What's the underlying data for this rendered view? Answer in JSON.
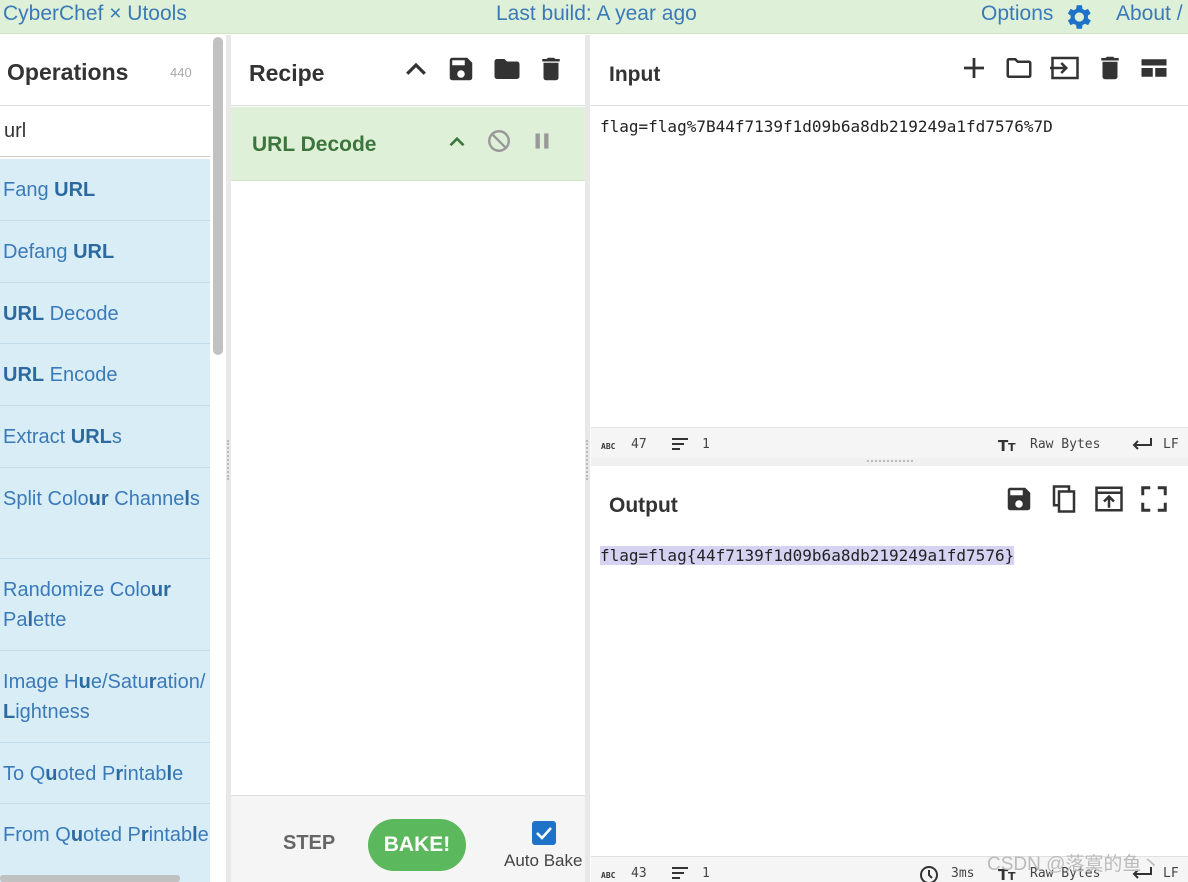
{
  "topbar": {
    "brand": "CyberChef × Utools",
    "build": "Last build: A year ago",
    "options": "Options",
    "about": "About /"
  },
  "operations": {
    "title": "Operations",
    "count": "440",
    "search_value": "url",
    "items": [
      "Fang URL",
      "Defang URL",
      "URL Decode",
      "URL Encode",
      "Extract URLs",
      "Split Colour Channels",
      "Randomize Colour Palette",
      "Image Hue/Saturation/Lightness",
      "To Quoted Printable",
      "From Quoted Printable"
    ]
  },
  "recipe": {
    "title": "Recipe",
    "operation": "URL Decode",
    "step_label": "STEP",
    "bake_label": "BAKE!",
    "auto_bake_label": "Auto Bake",
    "auto_bake_checked": true
  },
  "input": {
    "title": "Input",
    "text": "flag=flag%7B44f7139f1d09b6a8db219249a1fd7576%7D",
    "status": {
      "chars": "47",
      "lines": "1",
      "encoding": "Raw Bytes",
      "eol": "LF"
    }
  },
  "output": {
    "title": "Output",
    "text": "flag=flag{44f7139f1d09b6a8db219249a1fd7576}",
    "status": {
      "chars": "43",
      "lines": "1",
      "time": "3ms",
      "encoding": "Raw Bytes",
      "eol": "LF"
    }
  },
  "watermark": "CSDN @落寞的鱼丶",
  "colors": {
    "accent": "#3a7ab8",
    "bake": "#5cb85c",
    "recipe_card": "#dff0d8",
    "op_item": "#d9edf7"
  }
}
